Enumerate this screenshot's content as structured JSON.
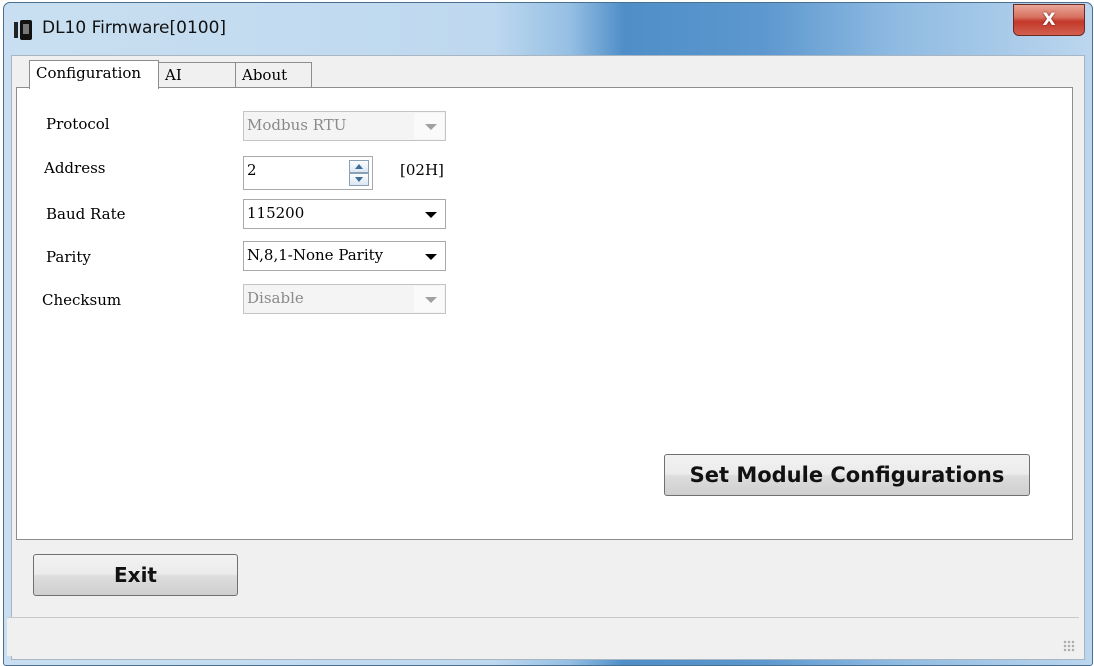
{
  "window": {
    "title": "DL10 Firmware[0100]",
    "close_label": "X"
  },
  "tabs": [
    {
      "label": "Configuration",
      "active": true
    },
    {
      "label": "AI",
      "active": false
    },
    {
      "label": "About",
      "active": false
    }
  ],
  "form": {
    "protocol": {
      "label": "Protocol",
      "value": "Modbus RTU",
      "enabled": false
    },
    "address": {
      "label": "Address",
      "value": "2",
      "hex": "[02H]"
    },
    "baud_rate": {
      "label": "Baud Rate",
      "value": "115200",
      "enabled": true
    },
    "parity": {
      "label": "Parity",
      "value": "N,8,1-None Parity",
      "enabled": true
    },
    "checksum": {
      "label": "Checksum",
      "value": "Disable",
      "enabled": false
    }
  },
  "buttons": {
    "set_config": "Set Module Configurations",
    "exit": "Exit"
  }
}
